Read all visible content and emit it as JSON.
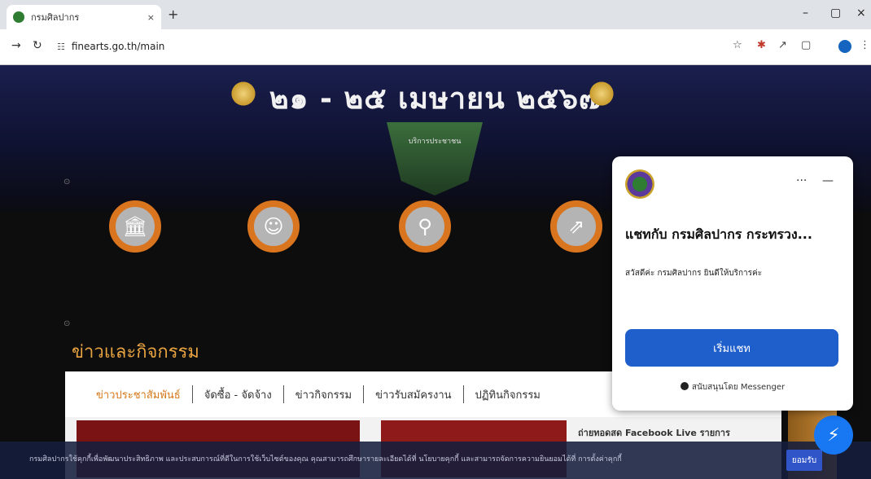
{
  "browser": {
    "tab_title": "กรมศิลปากร",
    "tab_close": "×",
    "new_tab": "+",
    "url": "finearts.go.th/main",
    "site_info": "☷",
    "window_minimize": "–",
    "window_restore": "▢",
    "window_close": "×",
    "nav_back": "→",
    "nav_reload": "↻",
    "ext_star": "☆",
    "ext_puzzle": "✱",
    "ext_pin": "↗",
    "ext_panel": "▢",
    "more": "⋮"
  },
  "banner": {
    "date": "๒๑ - ๒๕ เมษายน ๒๕๖๗",
    "service_label": "บริการประชาชน"
  },
  "news": {
    "heading": "ข่าวและกิจกรรม",
    "tabs": [
      "ข่าวประชาสัมพันธ์",
      "จัดซื้อ - จัดจ้าง",
      "ข่าวกิจกรรม",
      "ข่าวรับสมัครงาน",
      "ปฏิทินกิจกรรม"
    ],
    "card_text": "ถ่ายทอดสด Facebook Live รายการ"
  },
  "chat": {
    "title": "แชทกับ กรมศิลปากร กระทรวง...",
    "greeting": "สวัสดีค่ะ กรมศิลปากร ยินดีให้บริการค่ะ",
    "start_button": "เริ่มแชท",
    "powered_by": "สนับสนุนโดย Messenger",
    "more": "···",
    "minimize": "—"
  },
  "cookie": {
    "text": "กรมศิลปากรใช้คุกกี้เพื่อพัฒนาประสิทธิภาพ และประสบการณ์ที่ดีในการใช้เว็บไซต์ของคุณ คุณสามารถศึกษารายละเอียดได้ที่ นโยบายคุกกี้ และสามารถจัดการความยินยอมได้ที่ การตั้งค่าคุกกี้",
    "accept": "ยอมรับ"
  },
  "colors": {
    "accent_orange": "#d9741f",
    "news_heading": "#e8a341",
    "chat_button": "#1f5fcc"
  }
}
